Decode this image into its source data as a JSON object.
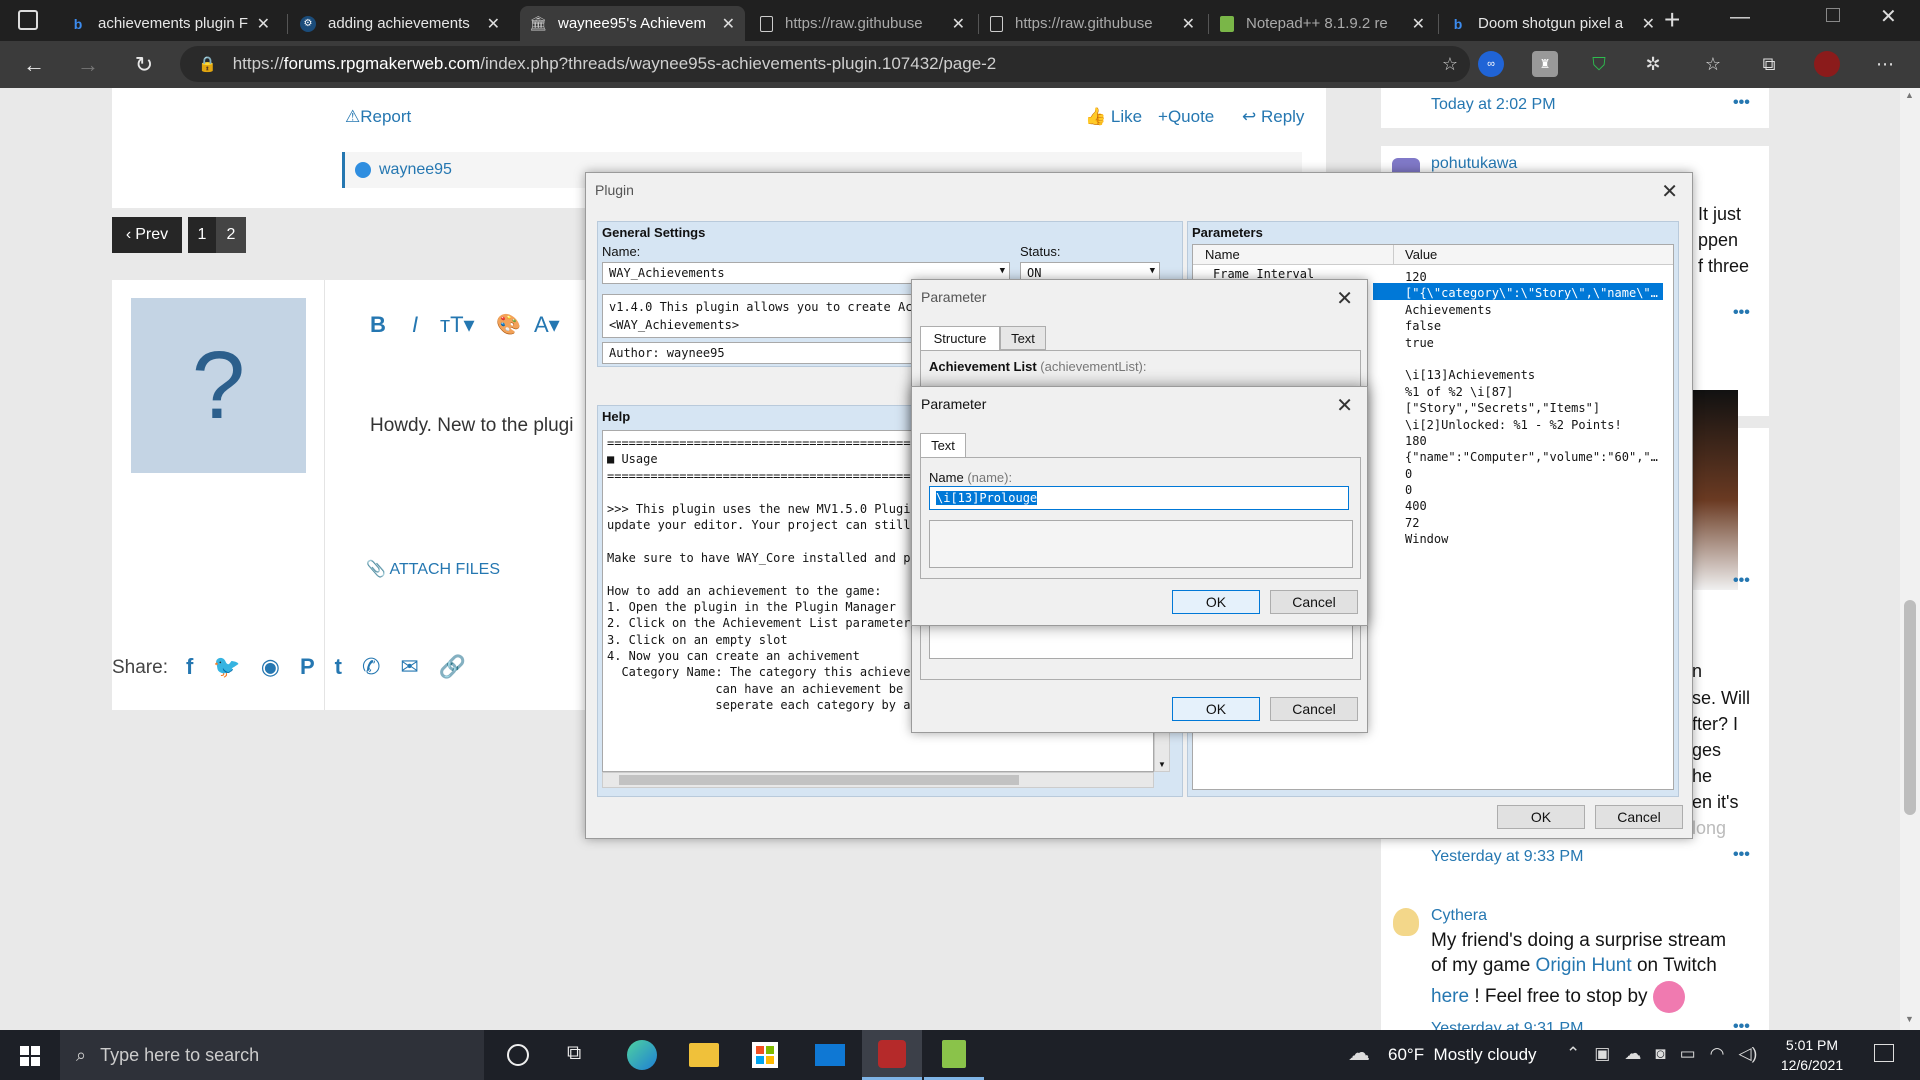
{
  "tabs": [
    {
      "title": "achievements plugin F",
      "icon": "bing-icon"
    },
    {
      "title": "adding achievements",
      "icon": "steam-icon"
    },
    {
      "title": "waynee95's Achievem",
      "icon": "forum-icon"
    },
    {
      "title": "https://raw.githubuse",
      "icon": "page-icon"
    },
    {
      "title": "https://raw.githubuse",
      "icon": "page-icon"
    },
    {
      "title": "Notepad++ 8.1.9.2 re",
      "icon": "notepad-icon"
    },
    {
      "title": "Doom shotgun pixel a",
      "icon": "bing-icon"
    }
  ],
  "address": {
    "prefix": "https://",
    "host": "forums.rpgmakerweb.com",
    "path": "/index.php?threads/waynee95s-achievements-plugin.107432/page-2"
  },
  "post": {
    "report": "Report",
    "like": "Like",
    "quote": "Quote",
    "reply": "Reply",
    "liked_by": "waynee95"
  },
  "pagination": {
    "prev": "Prev",
    "pages": [
      "1",
      "2"
    ]
  },
  "editor": {
    "body_text": "Howdy. New to the plugi",
    "attach": "ATTACH FILES",
    "avatar": "?"
  },
  "share": {
    "label": "Share:"
  },
  "sidebar": {
    "time1": "Today at 2:02 PM",
    "user2": "pohutukawa",
    "frag1": "It just",
    "frag2": "ppen",
    "frag3": "f three",
    "frag4": "se. Will",
    "frag5": "fter? I",
    "frag6": "ges",
    "frag7": "he",
    "frag8": "en it's",
    "frag9": "long",
    "frag10": "n",
    "time2": "Yesterday at 9:33 PM",
    "user3": "Cythera",
    "msg3a": "My friend's doing a surprise stream",
    "msg3b_pre": "of my game",
    "msg3b_link": "Origin Hunt",
    "msg3b_post": "on Twitch",
    "msg3c_link": "here",
    "msg3c_post": "! Feel free to stop by",
    "time3": "Yesterday at 9:31 PM",
    "more": "•••"
  },
  "plugin": {
    "title": "Plugin",
    "general_settings": "General Settings",
    "name_label": "Name:",
    "name_value": "WAY_Achievements",
    "status_label": "Status:",
    "status_value": "ON",
    "description": "v1.4.0 This plugin allows you to create Achi",
    "description2": "<WAY_Achievements>",
    "author": "Author: waynee95",
    "help_label": "Help",
    "help_lines": [
      "===========================================",
      "■ Usage",
      "===========================================",
      "",
      ">>> This plugin uses the new MV1.5.0 Plugin",
      "update your editor. Your project can still b",
      "",
      "Make sure to have WAY_Core installed and pla",
      "",
      "How to add an achievement to the game:",
      "1. Open the plugin in the Plugin Manager",
      "2. Click on the Achievement List parameter",
      "3. Click on an empty slot",
      "4. Now you can create an achivement",
      "  Category Name: The category this achieveme",
      "               can have an achievement be part of multiple categories, just",
      "               seperate each category by a space)"
    ],
    "parameters_label": "Parameters",
    "col_name": "Name",
    "col_value": "Value",
    "param_names": [
      "Frame Interval"
    ],
    "param_values": [
      "120",
      "[\"{\\\"category\\\":\\\"Story\\\",\\\"name\\\"…",
      "Achievements",
      "false",
      "true",
      "",
      "\\i[13]Achievements",
      "%1 of %2 \\i[87]",
      "[\"Story\",\"Secrets\",\"Items\"]",
      "\\i[2]Unlocked: %1 - %2 Points!",
      "180",
      "{\"name\":\"Computer\",\"volume\":\"60\",\"…",
      "0",
      "0",
      "400",
      "72",
      "Window"
    ],
    "ok": "OK",
    "cancel": "Cancel"
  },
  "param1": {
    "title": "Parameter",
    "tab_structure": "Structure",
    "tab_text": "Text",
    "field_label": "Achievement List",
    "field_key": "(achievementList):",
    "ok": "OK",
    "cancel": "Cancel"
  },
  "param2": {
    "title": "Parameter",
    "tab_text": "Text",
    "name_label": "Name",
    "name_key": "(name):",
    "name_value": "\\i[13]Prolouge",
    "ok": "OK",
    "cancel": "Cancel"
  },
  "taskbar": {
    "search_placeholder": "Type here to search",
    "weather": "60°F  Mostly cloudy",
    "time": "5:01 PM",
    "date": "12/6/2021"
  },
  "colors": {
    "accent": "#2577b1",
    "dialog_panel": "#d6e5f3",
    "selection": "#0078d7"
  }
}
